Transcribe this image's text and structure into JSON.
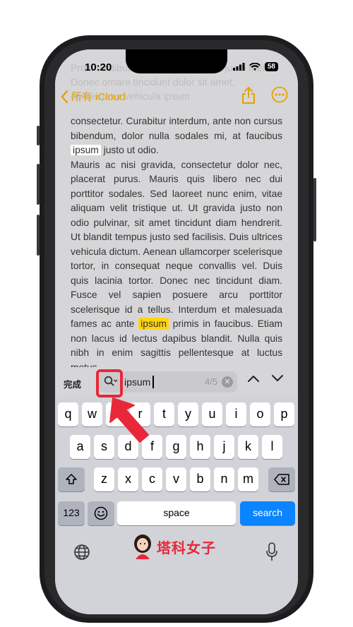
{
  "status": {
    "time": "10:20",
    "battery": "58"
  },
  "nav": {
    "back_label": "所有 iCloud"
  },
  "note": {
    "faint_text": "Proin vestibulum semper ipsum, at justo metus. Donec ornare tincidunt dolor sit amet, consectetur vehicula ipsum",
    "p1": "consectetur. Curabitur interdum, ante non cursus bibendum, dolor nulla sodales mi, at faucibus ",
    "match_current": "ipsum",
    "p1_tail": " justo ut odio.",
    "p2a": "Mauris ac nisi gravida, consectetur dolor nec, placerat purus. Mauris quis libero nec dui porttitor sodales. Sed laoreet nunc enim, vitae aliquam velit tristique ut. Ut gravida justo non odio pulvinar, sit amet tincidunt diam hendrerit. Ut blandit tempus justo sed facilisis. Duis ultrices vehicula dictum. Aenean ullamcorper scelerisque tortor, in consequat neque convallis vel. Duis quis lacinia tortor. Donec nec tincidunt diam. Fusce vel sapien posuere arcu porttitor scelerisque id a tellus. Interdum et malesuada fames ac ante ",
    "match_highlight": "ipsum",
    "p2b": " primis in faucibus. Etiam non lacus id lectus dapibus blandit. Nulla quis nibh in enim sagittis pellentesque at luctus metus."
  },
  "find": {
    "done_label": "完成",
    "query": "ipsum",
    "count": "4/5"
  },
  "keyboard": {
    "row1": [
      "q",
      "w",
      "e",
      "r",
      "t",
      "y",
      "u",
      "i",
      "o",
      "p"
    ],
    "row2": [
      "a",
      "s",
      "d",
      "f",
      "g",
      "h",
      "j",
      "k",
      "l"
    ],
    "row3": [
      "z",
      "x",
      "c",
      "v",
      "b",
      "n",
      "m"
    ],
    "num_label": "123",
    "space_label": "space",
    "search_label": "search"
  },
  "watermark": {
    "text": "塔科女子"
  },
  "colors": {
    "accent": "#e6a100",
    "search_blue": "#0a84ff",
    "annotation_red": "#e8283a",
    "highlight_yellow": "#ffd60a"
  }
}
